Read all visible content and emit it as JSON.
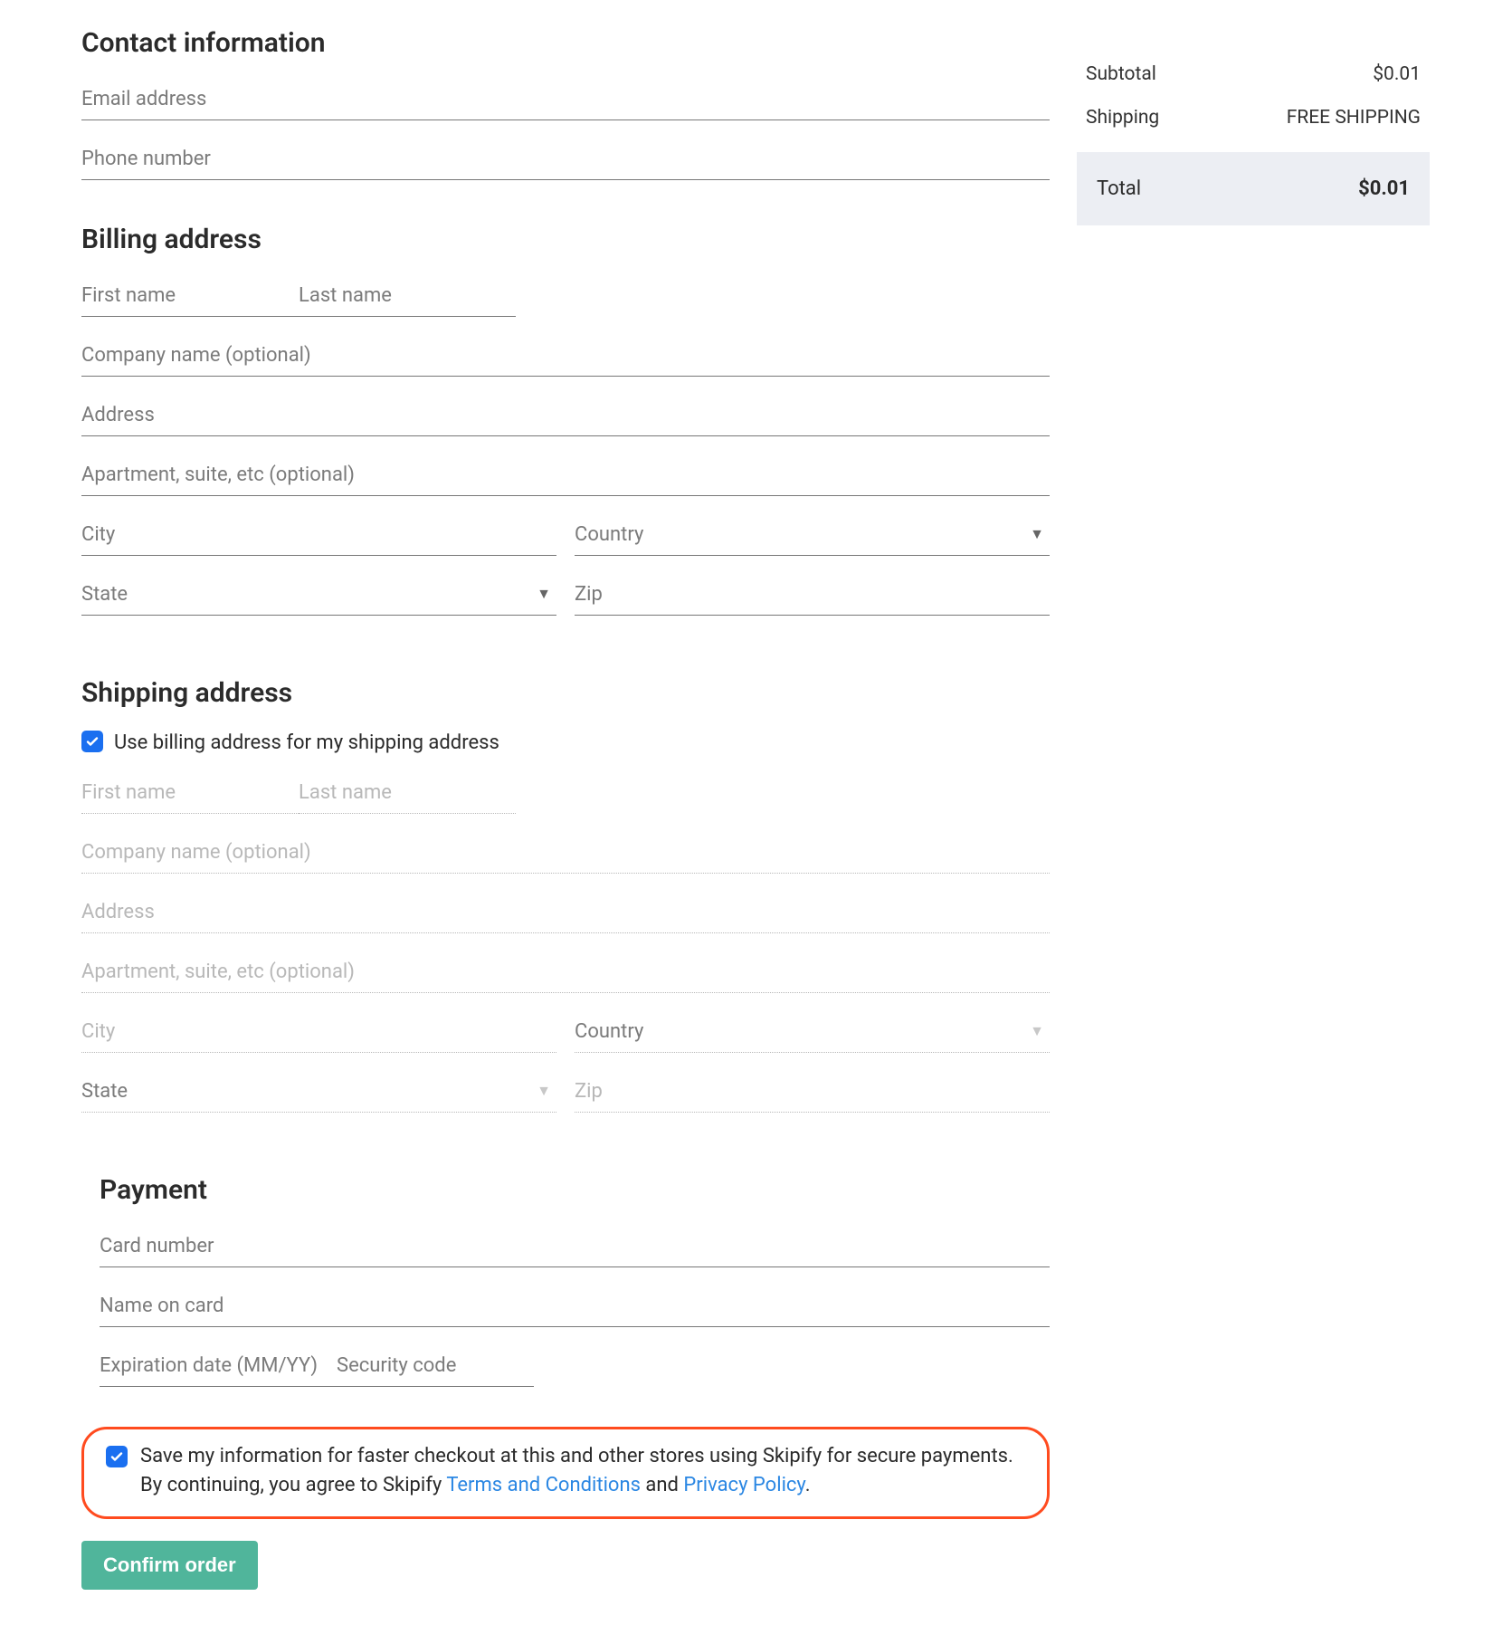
{
  "contact": {
    "title": "Contact information",
    "email_ph": "Email address",
    "phone_ph": "Phone number"
  },
  "billing": {
    "title": "Billing address",
    "first_ph": "First name",
    "last_ph": "Last name",
    "company_ph": "Company name (optional)",
    "address_ph": "Address",
    "apt_ph": "Apartment, suite, etc (optional)",
    "city_ph": "City",
    "country_ph": "Country",
    "state_ph": "State",
    "zip_ph": "Zip"
  },
  "shipping": {
    "title": "Shipping address",
    "use_billing_label": "Use billing address for my shipping address",
    "first_ph": "First name",
    "last_ph": "Last name",
    "company_ph": "Company name (optional)",
    "address_ph": "Address",
    "apt_ph": "Apartment, suite, etc (optional)",
    "city_ph": "City",
    "country_ph": "Country",
    "state_ph": "State",
    "zip_ph": "Zip"
  },
  "payment": {
    "title": "Payment",
    "card_ph": "Card number",
    "name_ph": "Name on card",
    "exp_ph": "Expiration date (MM/YY)",
    "cvv_ph": "Security code"
  },
  "save": {
    "line1": "Save my information for faster checkout at this and other stores using Skipify for secure payments.",
    "line2a": "By continuing, you agree to Skipify ",
    "terms": "Terms and Conditions",
    "and": " and ",
    "privacy": "Privacy Policy",
    "period": "."
  },
  "confirm_label": "Confirm order",
  "summary": {
    "subtotal_label": "Subtotal",
    "subtotal_value": "$0.01",
    "shipping_label": "Shipping",
    "shipping_value": "FREE SHIPPING",
    "total_label": "Total",
    "total_value": "$0.01"
  }
}
